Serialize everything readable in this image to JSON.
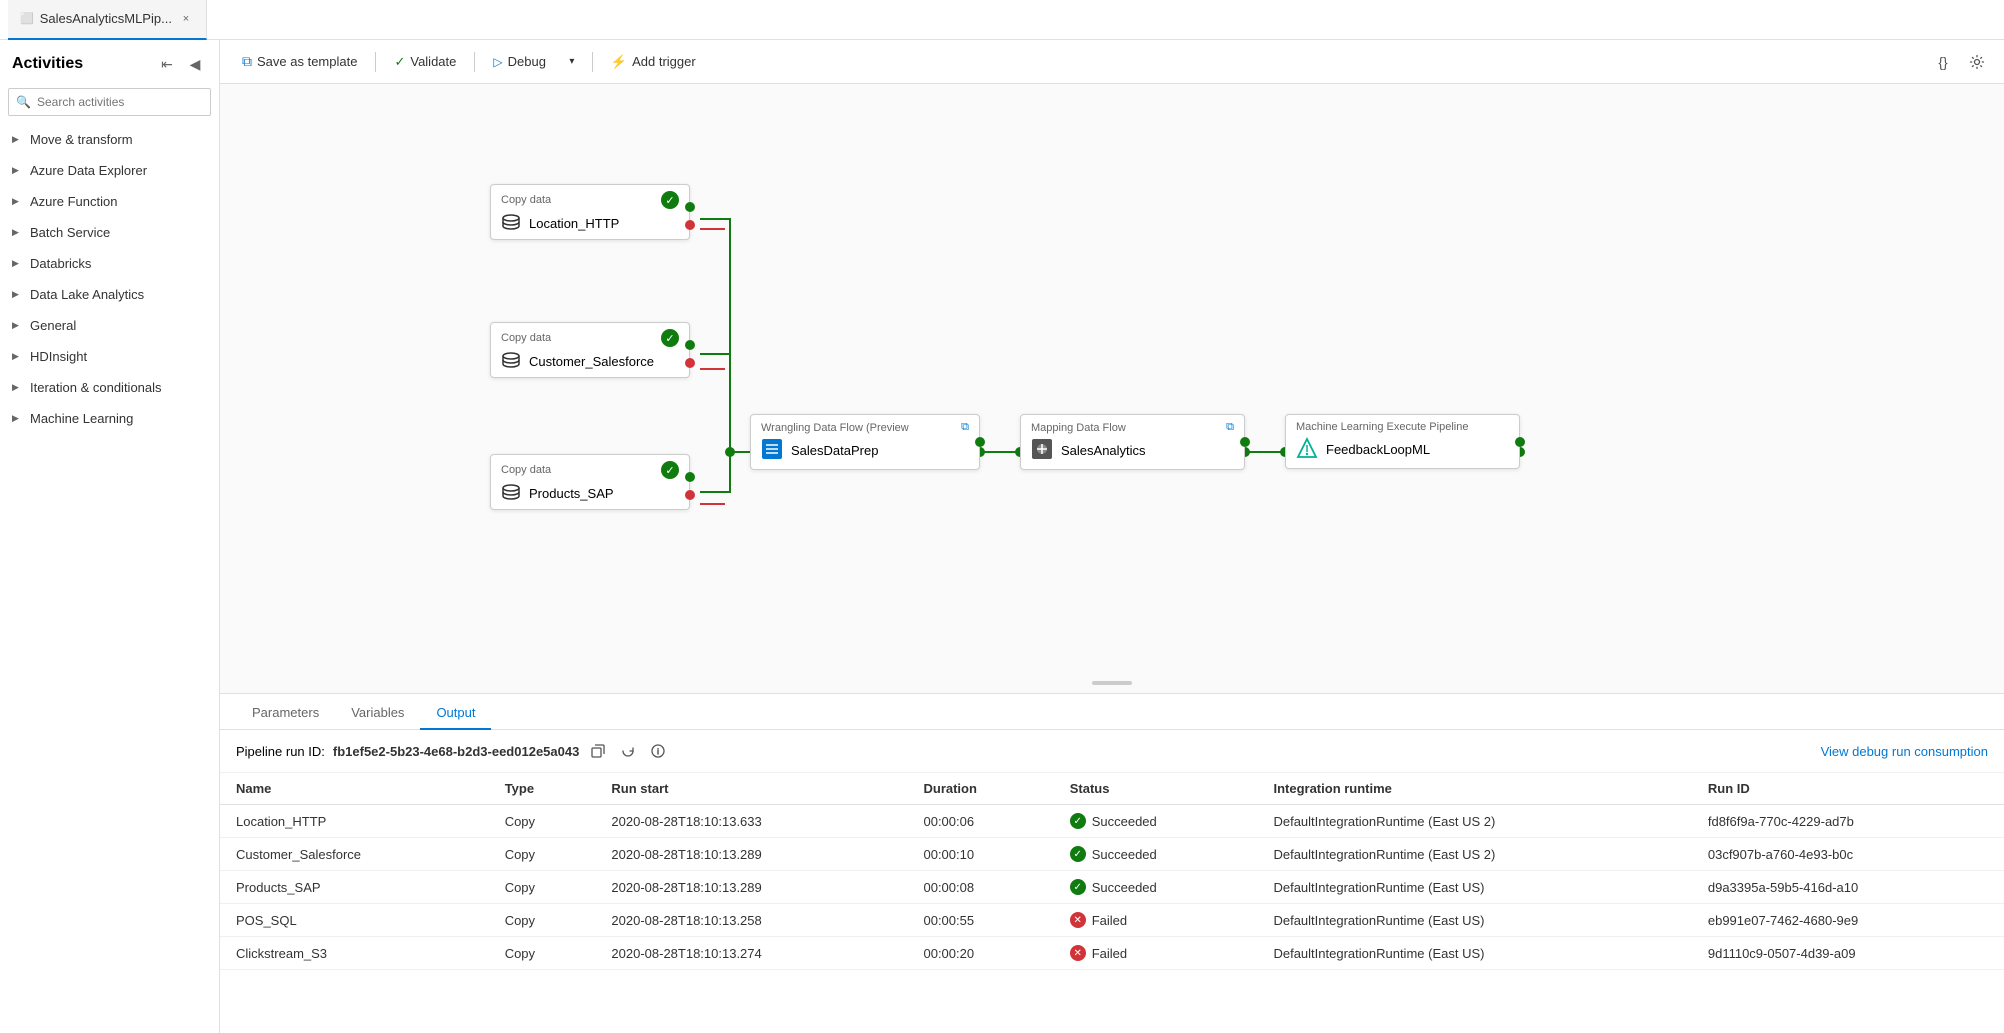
{
  "tab": {
    "title": "SalesAnalyticsMLPip...",
    "close_label": "×"
  },
  "toolbar": {
    "save_as_template_label": "Save as template",
    "validate_label": "Validate",
    "debug_label": "Debug",
    "add_trigger_label": "Add trigger",
    "code_icon": "{}",
    "settings_icon": "⚙"
  },
  "sidebar": {
    "title": "Activities",
    "search_placeholder": "Search activities",
    "collapse_icon": "↙",
    "pin_icon": "📌",
    "nav_items": [
      {
        "label": "Move & transform",
        "id": "move-transform"
      },
      {
        "label": "Azure Data Explorer",
        "id": "azure-data-explorer"
      },
      {
        "label": "Azure Function",
        "id": "azure-function"
      },
      {
        "label": "Batch Service",
        "id": "batch-service"
      },
      {
        "label": "Databricks",
        "id": "databricks"
      },
      {
        "label": "Data Lake Analytics",
        "id": "data-lake-analytics"
      },
      {
        "label": "General",
        "id": "general"
      },
      {
        "label": "HDInsight",
        "id": "hdinsight"
      },
      {
        "label": "Iteration & conditionals",
        "id": "iteration-conditionals"
      },
      {
        "label": "Machine Learning",
        "id": "machine-learning"
      }
    ]
  },
  "pipeline": {
    "nodes": {
      "copy1": {
        "header": "Copy data",
        "label": "Location_HTTP"
      },
      "copy2": {
        "header": "Copy data",
        "label": "Customer_Salesforce"
      },
      "copy3": {
        "header": "Copy data",
        "label": "Products_SAP"
      },
      "wrangling": {
        "header": "Wrangling Data Flow (Preview",
        "label": "SalesDataPrep",
        "external_link": "⧉"
      },
      "mapping": {
        "header": "Mapping Data Flow",
        "label": "SalesAnalytics",
        "external_link": "⧉"
      },
      "ml": {
        "header": "Machine Learning Execute Pipeline",
        "label": "FeedbackLoopML"
      }
    }
  },
  "output": {
    "tabs": [
      {
        "label": "Parameters",
        "id": "parameters"
      },
      {
        "label": "Variables",
        "id": "variables"
      },
      {
        "label": "Output",
        "id": "output",
        "active": true
      }
    ],
    "pipeline_run_label": "Pipeline run ID:",
    "pipeline_run_id": "fb1ef5e2-5b23-4e68-b2d3-eed012e5a043",
    "view_debug_label": "View debug run consumption",
    "table_headers": [
      "Name",
      "Type",
      "Run start",
      "Duration",
      "Status",
      "Integration runtime",
      "Run ID"
    ],
    "table_rows": [
      {
        "name": "Location_HTTP",
        "type": "Copy",
        "run_start": "2020-08-28T18:10:13.633",
        "duration": "00:00:06",
        "status": "Succeeded",
        "status_type": "success",
        "integration_runtime": "DefaultIntegrationRuntime (East US 2)",
        "run_id": "fd8f6f9a-770c-4229-ad7b"
      },
      {
        "name": "Customer_Salesforce",
        "type": "Copy",
        "run_start": "2020-08-28T18:10:13.289",
        "duration": "00:00:10",
        "status": "Succeeded",
        "status_type": "success",
        "integration_runtime": "DefaultIntegrationRuntime (East US 2)",
        "run_id": "03cf907b-a760-4e93-b0c"
      },
      {
        "name": "Products_SAP",
        "type": "Copy",
        "run_start": "2020-08-28T18:10:13.289",
        "duration": "00:00:08",
        "status": "Succeeded",
        "status_type": "success",
        "integration_runtime": "DefaultIntegrationRuntime (East US)",
        "run_id": "d9a3395a-59b5-416d-a10"
      },
      {
        "name": "POS_SQL",
        "type": "Copy",
        "run_start": "2020-08-28T18:10:13.258",
        "duration": "00:00:55",
        "status": "Failed",
        "status_type": "failed",
        "integration_runtime": "DefaultIntegrationRuntime (East US)",
        "run_id": "eb991e07-7462-4680-9e9"
      },
      {
        "name": "Clickstream_S3",
        "type": "Copy",
        "run_start": "2020-08-28T18:10:13.274",
        "duration": "00:00:20",
        "status": "Failed",
        "status_type": "failed",
        "integration_runtime": "DefaultIntegrationRuntime (East US)",
        "run_id": "9d1110c9-0507-4d39-a09"
      }
    ]
  }
}
